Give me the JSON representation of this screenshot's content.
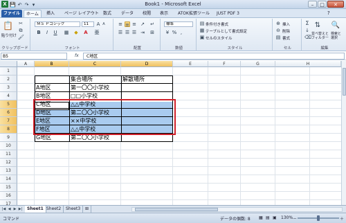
{
  "window": {
    "title": "Book1 - Microsoft Excel",
    "minimize": "–",
    "maximize": "□",
    "close": "✕"
  },
  "qat": {
    "save": "💾",
    "undo": "↶",
    "redo": "↷",
    "more": "▾"
  },
  "tabs": [
    "ファイル",
    "ホーム",
    "挿入",
    "ページ レイアウト",
    "数式",
    "データ",
    "校閲",
    "表示",
    "ATOK拡張ツール",
    "JUST PDF 3"
  ],
  "ribbon": {
    "clipboard": {
      "label": "クリップボード",
      "paste": "貼り付け"
    },
    "font": {
      "label": "フォント",
      "name": "ＭＳ Ｐゴシック",
      "size": "11",
      "bold": "B",
      "italic": "I",
      "underline": "U",
      "grow": "A",
      "shrink": "A",
      "color": "A",
      "phonetic": "亜"
    },
    "alignment": {
      "label": "配置"
    },
    "number": {
      "label": "数値",
      "format": "標準",
      "currency": "¥",
      "percent": "%",
      "comma": ","
    },
    "styles": {
      "label": "スタイル",
      "conditional": "条件付き書式",
      "table": "テーブルとして書式設定",
      "cell": "セルのスタイル"
    },
    "cells": {
      "label": "セル",
      "insert": "挿入",
      "delete": "削除",
      "format": "書式"
    },
    "editing": {
      "label": "編集",
      "sum": "Σ",
      "sort": "並べ替えと\nフィルター",
      "find": "検索と\n選択"
    }
  },
  "formula": {
    "namebox": "B5",
    "fx": "fx",
    "content": "C地区"
  },
  "columns": [
    "A",
    "B",
    "C",
    "D",
    "E",
    "F",
    "G",
    "H"
  ],
  "rows": [
    "1",
    "2",
    "3",
    "4",
    "5",
    "6",
    "7",
    "8",
    "9",
    "10",
    "11",
    "12",
    "13",
    "14",
    "15",
    "16",
    "17"
  ],
  "cells": {
    "c3": "集合場所",
    "d3": "解散場所",
    "b4": "A地区",
    "c4": "第一〇〇小学校",
    "b5": "B地区",
    "c5": "□□小学校",
    "b6": "C地区",
    "c6": "△△中学校",
    "b7": "D地区",
    "c7": "第二〇〇小学校",
    "b8": "E地区",
    "c8": "××中学校",
    "b9": "F地区",
    "c9": "△△中学校",
    "b10": "G地区",
    "c10": "第二〇〇小学校"
  },
  "sheets": [
    "Sheet1",
    "Sheet2",
    "Sheet3"
  ],
  "status": {
    "mode": "コマンド",
    "count": "データの個数: 8",
    "zoom": "130%",
    "minus": "－",
    "plus": "＋"
  },
  "colors": {
    "selection": "#a9cbef",
    "redbox": "#d0202a",
    "filetab": "#2a5ea8"
  }
}
